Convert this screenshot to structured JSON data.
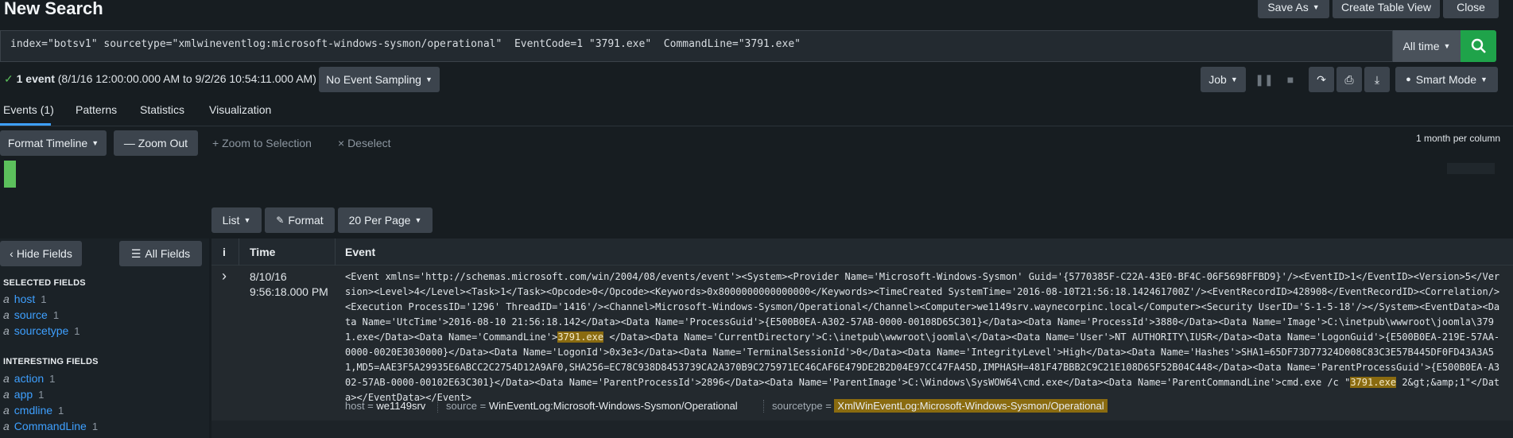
{
  "header": {
    "title": "New Search",
    "save_as": "Save As",
    "create_table_view": "Create Table View",
    "close": "Close"
  },
  "search": {
    "query": "index=\"botsv1\" sourcetype=\"xmlwineventlog:microsoft-windows-sysmon/operational\"  EventCode=1 \"3791.exe\"  CommandLine=\"3791.exe\"",
    "time_range": "All time"
  },
  "status": {
    "count": "1 event",
    "range": "(8/1/16 12:00:00.000 AM to 9/2/26 10:54:11.000 AM)",
    "sampling": "No Event Sampling",
    "job": "Job",
    "mode": "Smart Mode"
  },
  "tabs": [
    "Events (1)",
    "Patterns",
    "Statistics",
    "Visualization"
  ],
  "timeline": {
    "format": "Format Timeline",
    "zoom_out": "— Zoom Out",
    "zoom_selection": "+ Zoom to Selection",
    "deselect": "× Deselect",
    "scale": "1 month per column"
  },
  "results_toolbar": {
    "list": "List",
    "format": "Format",
    "per_page": "20 Per Page"
  },
  "fields": {
    "hide": "Hide Fields",
    "all": "All Fields",
    "selected_title": "SELECTED FIELDS",
    "selected": [
      {
        "type": "a",
        "name": "host",
        "count": "1"
      },
      {
        "type": "a",
        "name": "source",
        "count": "1"
      },
      {
        "type": "a",
        "name": "sourcetype",
        "count": "1"
      }
    ],
    "interesting_title": "INTERESTING FIELDS",
    "interesting": [
      {
        "type": "a",
        "name": "action",
        "count": "1"
      },
      {
        "type": "a",
        "name": "app",
        "count": "1"
      },
      {
        "type": "a",
        "name": "cmdline",
        "count": "1"
      },
      {
        "type": "a",
        "name": "CommandLine",
        "count": "1"
      }
    ]
  },
  "table": {
    "col_info": "i",
    "col_time": "Time",
    "col_event": "Event",
    "row": {
      "date": "8/10/16",
      "time": "9:56:18.000 PM",
      "event_part1": "<Event xmlns='http://schemas.microsoft.com/win/2004/08/events/event'><System><Provider Name='Microsoft-Windows-Sysmon' Guid='{5770385F-C22A-43E0-BF4C-06F5698FFBD9}'/><EventID>1</EventID><Version>5</Version><Level>4</Level><Task>1</Task><Opcode>0</Opcode><Keywords>0x8000000000000000</Keywords><TimeCreated SystemTime='2016-08-10T21:56:18.142461700Z'/><EventRecordID>428908</EventRecordID><Correlation/><Execution ProcessID='1296' ThreadID='1416'/><Channel>Microsoft-Windows-Sysmon/Operational</Channel><Computer>we1149srv.waynecorpinc.local</Computer><Security UserID='S-1-5-18'/></System><EventData><Data Name='UtcTime'>2016-08-10 21:56:18.142</Data><Data Name='ProcessGuid'>{E500B0EA-A302-57AB-0000-00108D65C301}</Data><Data Name='ProcessId'>3880</Data><Data Name='Image'>C:\\inetpub\\wwwroot\\joomla\\3791.exe</Data><Data Name='CommandLine'>",
      "highlight1": "3791.exe",
      "event_part2": "  </Data><Data Name='CurrentDirectory'>C:\\inetpub\\wwwroot\\joomla\\</Data><Data Name='User'>NT AUTHORITY\\IUSR</Data><Data Name='LogonGuid'>{E500B0EA-219E-57AA-0000-0020E3030000}</Data><Data Name='LogonId'>0x3e3</Data><Data Name='TerminalSessionId'>0</Data><Data Name='IntegrityLevel'>High</Data><Data Name='Hashes'>SHA1=65DF73D77324D008C83C3E57B445DF0FD43A3A51,MD5=AAE3F5A29935E6ABCC2C2754D12A9AF0,SHA256=EC78C938D8453739CA2A370B9C275971EC46CAF6E479DE2B2D04E97CC47FA45D,IMPHASH=481F47BBB2C9C21E108D65F52B04C448</Data><Data Name='ParentProcessGuid'>{E500B0EA-A302-57AB-0000-00102E63C301}</Data><Data Name='ParentProcessId'>2896</Data><Data Name='ParentImage'>C:\\Windows\\SysWOW64\\cmd.exe</Data><Data Name='ParentCommandLine'>cmd.exe /c \"",
      "highlight2": "3791.exe",
      "event_part3": " 2&gt;&amp;1\"</Data></EventData></Event>",
      "host_key": "host =",
      "host_val": "we1149srv",
      "source_key": "source =",
      "source_val": "WinEventLog:Microsoft-Windows-Sysmon/Operational",
      "sourcetype_key": "sourcetype =",
      "sourcetype_val": "XmlWinEventLog:Microsoft-Windows-Sysmon/Operational"
    }
  },
  "icons": {
    "search": "search-icon",
    "pause": "pause-icon",
    "stop": "stop-icon",
    "share": "share-icon",
    "print": "print-icon",
    "export": "download-icon",
    "bulb": "lightbulb-icon",
    "expand": "chevron-right-icon"
  },
  "colors": {
    "search_button": "#1fa34a",
    "highlight": "#8a6b10",
    "link": "#3ea0ff",
    "timeline_bar": "#5cc05c"
  }
}
